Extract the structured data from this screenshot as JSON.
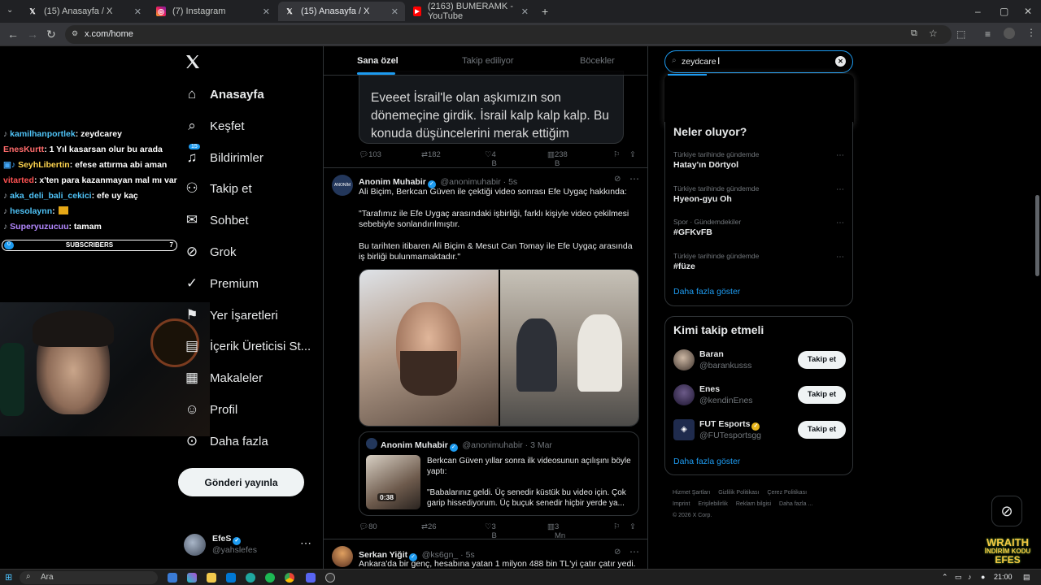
{
  "browser": {
    "tabs": [
      {
        "title": "(15) Anasayfa / X",
        "icon": "x-logo-icon"
      },
      {
        "title": "(7) Instagram",
        "icon": "instagram-icon"
      },
      {
        "title": "(15) Anasayfa / X",
        "icon": "x-logo-icon"
      },
      {
        "title": "(2163) BUMERAMK - YouTube",
        "icon": "youtube-icon"
      }
    ],
    "url": "x.com/home"
  },
  "stream": {
    "chat": [
      {
        "user": "kamilhanportlek",
        "msg": ": zeydcarey",
        "color": "#4fc3f7"
      },
      {
        "user": "EnesKurtt",
        "msg": ": 1 Yıl kasarsan olur bu arada",
        "color": "#ff6b6b"
      },
      {
        "user": "SeyhLibertin",
        "msg": ": efese attırma abi aman",
        "color": "#ffd54f"
      },
      {
        "user": "vitarted",
        "msg": ": x'ten para kazanmayan mal mı var",
        "color": "#ff5252"
      },
      {
        "user": "aka_deli_bali_cekici",
        "msg": ": efe uy kaç",
        "color": "#4fc3f7"
      },
      {
        "user": "hesolaynn",
        "msg": ":",
        "color": "#4fc3f7"
      },
      {
        "user": "Superyuzucuu",
        "msg": ": tamam",
        "color": "#b388ff"
      }
    ],
    "subs_label": "SUBSCRIBERS",
    "subs_current": "0",
    "subs_goal": "7",
    "progress": 0
  },
  "nav": {
    "items": [
      {
        "label": "Anasayfa",
        "icon": "home-icon"
      },
      {
        "label": "Keşfet",
        "icon": "search-icon"
      },
      {
        "label": "Bildirimler",
        "icon": "bell-icon",
        "badge": "15"
      },
      {
        "label": "Takip et",
        "icon": "add-user-icon"
      },
      {
        "label": "Sohbet",
        "icon": "mail-icon"
      },
      {
        "label": "Grok",
        "icon": "grok-icon"
      },
      {
        "label": "Premium",
        "icon": "premium-icon"
      },
      {
        "label": "Yer İşaretleri",
        "icon": "bookmark-icon"
      },
      {
        "label": "İçerik Üreticisi St...",
        "icon": "studio-icon"
      },
      {
        "label": "Makaleler",
        "icon": "article-icon"
      },
      {
        "label": "Profil",
        "icon": "profile-icon"
      },
      {
        "label": "Daha fazla",
        "icon": "more-circle-icon"
      }
    ],
    "post_button": "Gönderi yayınla",
    "account": {
      "name": "EfeS",
      "handle": "@yahslefes"
    }
  },
  "feed": {
    "tabs": [
      "Sana özel",
      "Takip ediliyor",
      "Böcekler"
    ],
    "post0": {
      "card_text": "Eveeet İsrail'le olan aşkımızın son dönemeçine girdik. İsrail kalp kalp kalp. Bu konuda düşüncelerini merak ettiğim",
      "replies": "103",
      "reposts": "182",
      "likes": "4 B",
      "views": "238 B"
    },
    "post1": {
      "name": "Anonim Muhabir",
      "handle": "@anonimuhabir · 5s",
      "line1": "Ali Biçim, Berkcan Güven ile çektiği video sonrası Efe Uygaç hakkında:",
      "line2": "\"Tarafımız ile Efe Uygaç arasındaki işbirliği, farklı kişiyle video çekilmesi sebebiyle sonlandırılmıştır.",
      "line3": "Bu tarihten itibaren Ali Biçim & Mesut Can Tomay ile Efe Uygaç arasında iş birliği bulunmamaktadır.\"",
      "quote": {
        "name": "Anonim Muhabir",
        "handle": "@anonimuhabir · 3 Mar",
        "text1": "Berkcan Güven yıllar sonra ilk videosunun açılışını böyle yaptı:",
        "text2": "\"Babalarınız geldi. Üç senedir küstük bu video için. Çok garip hissediyorum. Üç buçuk senedir hiçbir yerde ya...",
        "duration": "0:38"
      },
      "replies": "80",
      "reposts": "26",
      "likes": "3 B",
      "views": "3 Mn"
    },
    "post2": {
      "name": "Serkan Yiğit",
      "handle": "@ks6gn_ · 5s",
      "text": "Ankara'da bir genç, hesabına yatan 1 milyon 488 bin TL'yi çatır çatır yedi."
    }
  },
  "right": {
    "search_value": "zeydcare",
    "trends_title": "Neler oluyor?",
    "trends": [
      {
        "cat": "Türkiye tarihinde gündemde",
        "name": "Hatay'ın Dörtyol"
      },
      {
        "cat": "Türkiye tarihinde gündemde",
        "name": "Hyeon-gyu Oh"
      },
      {
        "cat": "Spor · Gündemdekiler",
        "name": "#GFKvFB"
      },
      {
        "cat": "Türkiye tarihinde gündemde",
        "name": "#füze"
      }
    ],
    "trends_more": "Daha fazla göster",
    "who_title": "Kimi takip etmeli",
    "who": [
      {
        "name": "Baran",
        "handle": "@barankusss",
        "btn": "Takip et",
        "verified": false
      },
      {
        "name": "Enes",
        "handle": "@kendinEnes",
        "btn": "Takip et",
        "verified": false
      },
      {
        "name": "FUT Esports",
        "handle": "@FUTesportsgg",
        "btn": "Takip et",
        "verified": true
      }
    ],
    "who_more": "Daha fazla göster",
    "footer": [
      "Hizmet Şartları",
      "Gizlilik Politikası",
      "Çerez Politikası",
      "Imprint",
      "Erişilebilirlik",
      "Reklam bilgisi",
      "Daha fazla ...",
      "© 2026 X Corp."
    ]
  },
  "taskbar": {
    "search": "Ara",
    "time": "21:00"
  },
  "overlay": {
    "brand_line1": "WRAITH",
    "brand_line2": "İNDİRİM KODU",
    "brand_line3": "EFES"
  }
}
